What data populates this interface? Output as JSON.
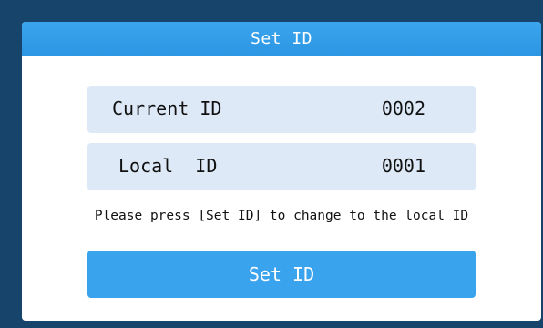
{
  "dialog": {
    "title": "Set ID",
    "current": {
      "label": "Current ID",
      "value": "0002"
    },
    "local": {
      "label": "Local  ID",
      "value": "0001"
    },
    "hint": "Please press [Set ID] to change to the local ID",
    "button_label": "Set ID"
  },
  "colors": {
    "background": "#16446b",
    "header": "#3aa6ee",
    "row": "#dde9f6",
    "button": "#3aa3ee"
  }
}
